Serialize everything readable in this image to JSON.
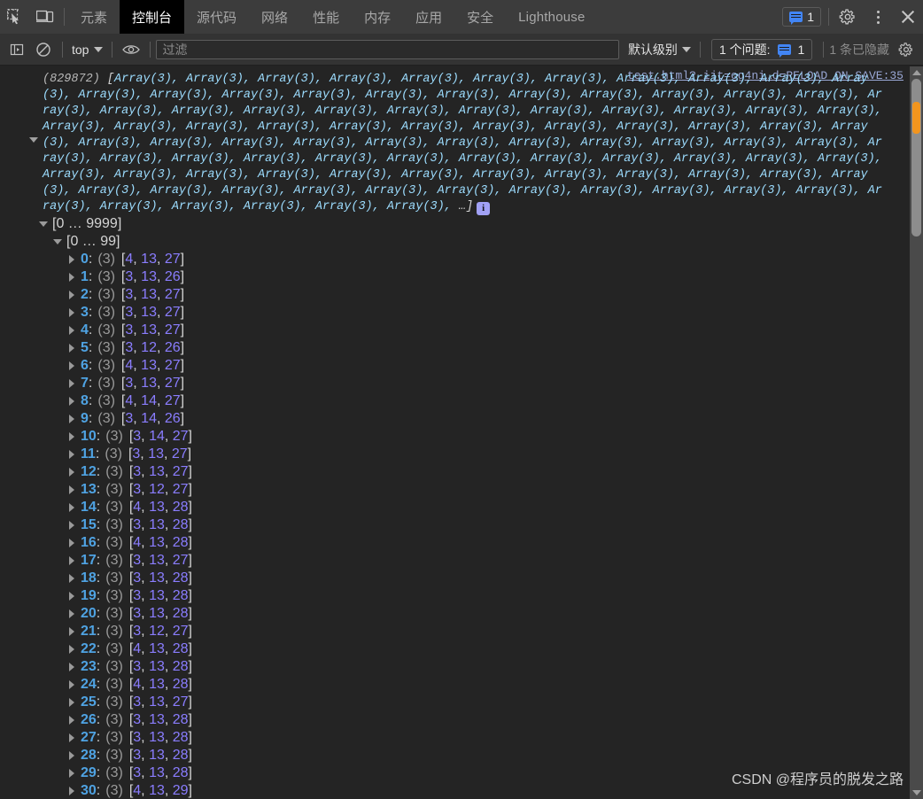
{
  "tabbar": {
    "inspect_icon": "inspect-element-icon",
    "device_icon": "device-toolbar-icon",
    "tabs": [
      {
        "label": "元素",
        "active": false
      },
      {
        "label": "控制台",
        "active": true
      },
      {
        "label": "源代码",
        "active": false
      },
      {
        "label": "网络",
        "active": false
      },
      {
        "label": "性能",
        "active": false
      },
      {
        "label": "内存",
        "active": false
      },
      {
        "label": "应用",
        "active": false
      },
      {
        "label": "安全",
        "active": false
      },
      {
        "label": "Lighthouse",
        "active": false
      }
    ],
    "issues_count": "1",
    "settings_icon": "gear-icon",
    "more_icon": "kebab-menu-icon",
    "close_icon": "close-icon"
  },
  "filterbar": {
    "sidebar_toggle_icon": "show-console-sidebar-icon",
    "clear_icon": "clear-console-icon",
    "context": "top",
    "eye_icon": "live-expression-icon",
    "filter_placeholder": "过滤",
    "filter_value": "",
    "level": "默认级别",
    "issues_label": "1 个问题:",
    "issues_count": "1",
    "hidden_label": "1 条已隐藏",
    "settings_icon": "console-settings-icon"
  },
  "console": {
    "source_link": "test.html?_ijt=og4ni…d=RELOAD_ON_SAVE:35",
    "array_count": "(829872)",
    "preview_item": "Array(3)",
    "preview_item_repeat": 98,
    "preview_ellipsis": "…]",
    "preview_open_bracket": "[",
    "info_badge_glyph": "i",
    "groups": [
      {
        "label": "[0 … 9999]",
        "expanded": true
      },
      {
        "label": "[0 … 99]",
        "expanded": true
      }
    ],
    "length_marker": "(3)",
    "rows": [
      {
        "index": "0",
        "len": "(3)",
        "values": [
          4,
          13,
          27
        ]
      },
      {
        "index": "1",
        "len": "(3)",
        "values": [
          3,
          13,
          26
        ]
      },
      {
        "index": "2",
        "len": "(3)",
        "values": [
          3,
          13,
          27
        ]
      },
      {
        "index": "3",
        "len": "(3)",
        "values": [
          3,
          13,
          27
        ]
      },
      {
        "index": "4",
        "len": "(3)",
        "values": [
          3,
          13,
          27
        ]
      },
      {
        "index": "5",
        "len": "(3)",
        "values": [
          3,
          12,
          26
        ]
      },
      {
        "index": "6",
        "len": "(3)",
        "values": [
          4,
          13,
          27
        ]
      },
      {
        "index": "7",
        "len": "(3)",
        "values": [
          3,
          13,
          27
        ]
      },
      {
        "index": "8",
        "len": "(3)",
        "values": [
          4,
          14,
          27
        ]
      },
      {
        "index": "9",
        "len": "(3)",
        "values": [
          3,
          14,
          26
        ]
      },
      {
        "index": "10",
        "len": "(3)",
        "values": [
          3,
          14,
          27
        ]
      },
      {
        "index": "11",
        "len": "(3)",
        "values": [
          3,
          13,
          27
        ]
      },
      {
        "index": "12",
        "len": "(3)",
        "values": [
          3,
          13,
          27
        ]
      },
      {
        "index": "13",
        "len": "(3)",
        "values": [
          3,
          12,
          27
        ]
      },
      {
        "index": "14",
        "len": "(3)",
        "values": [
          4,
          13,
          28
        ]
      },
      {
        "index": "15",
        "len": "(3)",
        "values": [
          3,
          13,
          28
        ]
      },
      {
        "index": "16",
        "len": "(3)",
        "values": [
          4,
          13,
          28
        ]
      },
      {
        "index": "17",
        "len": "(3)",
        "values": [
          3,
          13,
          27
        ]
      },
      {
        "index": "18",
        "len": "(3)",
        "values": [
          3,
          13,
          28
        ]
      },
      {
        "index": "19",
        "len": "(3)",
        "values": [
          3,
          13,
          28
        ]
      },
      {
        "index": "20",
        "len": "(3)",
        "values": [
          3,
          13,
          28
        ]
      },
      {
        "index": "21",
        "len": "(3)",
        "values": [
          3,
          12,
          27
        ]
      },
      {
        "index": "22",
        "len": "(3)",
        "values": [
          4,
          13,
          28
        ]
      },
      {
        "index": "23",
        "len": "(3)",
        "values": [
          3,
          13,
          28
        ]
      },
      {
        "index": "24",
        "len": "(3)",
        "values": [
          4,
          13,
          28
        ]
      },
      {
        "index": "25",
        "len": "(3)",
        "values": [
          3,
          13,
          27
        ]
      },
      {
        "index": "26",
        "len": "(3)",
        "values": [
          3,
          13,
          28
        ]
      },
      {
        "index": "27",
        "len": "(3)",
        "values": [
          3,
          13,
          28
        ]
      },
      {
        "index": "28",
        "len": "(3)",
        "values": [
          3,
          13,
          28
        ]
      },
      {
        "index": "29",
        "len": "(3)",
        "values": [
          3,
          13,
          28
        ]
      },
      {
        "index": "30",
        "len": "(3)",
        "values": [
          4,
          13,
          29
        ]
      }
    ]
  },
  "watermark": "CSDN @程序员的脱发之路",
  "colors": {
    "background": "#242424",
    "tabbar_bg": "#3c3c3c",
    "active_tab_bg": "#000000",
    "accent_blue": "#4285f4",
    "number": "#8a7dff",
    "key": "#4fa3e3",
    "preview_text": "#9cdcfe",
    "warn_marker": "#f2951e",
    "info_badge": "#a1a1f5"
  }
}
